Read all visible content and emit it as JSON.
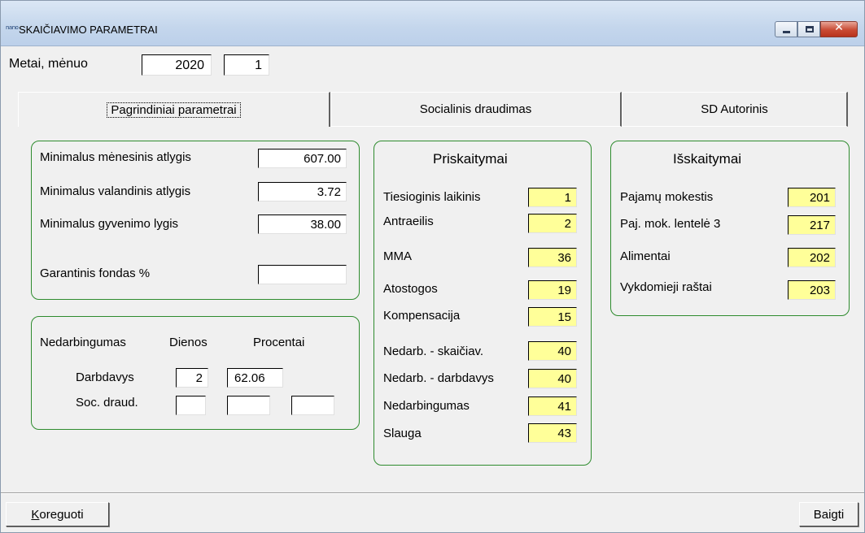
{
  "window": {
    "icon_text": "nano",
    "title": "SKAIČIAVIMO  PARAMETRAI",
    "close_glyph": "✕"
  },
  "period": {
    "label": "Metai, mėnuo",
    "year": "2020",
    "month": "1"
  },
  "tabs": [
    {
      "label": "Pagrindiniai parametrai",
      "active": true
    },
    {
      "label": "Socialinis draudimas",
      "active": false
    },
    {
      "label": "SD Autorinis",
      "active": false
    }
  ],
  "minimals": {
    "monthly_label": "Minimalus mėnesinis atlygis",
    "monthly_value": "607.00",
    "hourly_label": "Minimalus valandinis atlygis",
    "hourly_value": "3.72",
    "living_label": "Minimalus gyvenimo lygis",
    "living_value": "38.00",
    "guarantee_label": "Garantinis fondas %",
    "guarantee_value": ""
  },
  "disability": {
    "title_label": "Nedarbingumas",
    "days_header": "Dienos",
    "percent_header": "Procentai",
    "employer_label": "Darbdavys",
    "employer_days": "2",
    "employer_percent": "62.06",
    "social_label": "Soc. draud.",
    "social_days": "",
    "social_percent": "",
    "social_extra": ""
  },
  "accruals": {
    "title": "Priskaitymai",
    "items": [
      {
        "label": "Tiesioginis laikinis",
        "code": "1"
      },
      {
        "label": "Antraeilis",
        "code": "2"
      },
      {
        "label": "MMA",
        "code": "36"
      },
      {
        "label": "Atostogos",
        "code": "19"
      },
      {
        "label": "Kompensacija",
        "code": "15"
      },
      {
        "label": "Nedarb. - skaičiav.",
        "code": "40"
      },
      {
        "label": "Nedarb. - darbdavys",
        "code": "40"
      },
      {
        "label": "Nedarbingumas",
        "code": "41"
      },
      {
        "label": "Slauga",
        "code": "43"
      }
    ]
  },
  "deductions": {
    "title": "Išskaitymai",
    "items": [
      {
        "label": "Pajamų mokestis",
        "code": "201"
      },
      {
        "label": "Paj. mok. lentelė 3",
        "code": "217"
      },
      {
        "label": "Alimentai",
        "code": "202"
      },
      {
        "label": "Vykdomieji raštai",
        "code": "203"
      }
    ]
  },
  "buttons": {
    "edit_first": "K",
    "edit_rest": "oreguoti",
    "finish": "Baigti"
  },
  "colors": {
    "group_border": "#2e8b2e",
    "code_field_bg": "#ffff99"
  }
}
